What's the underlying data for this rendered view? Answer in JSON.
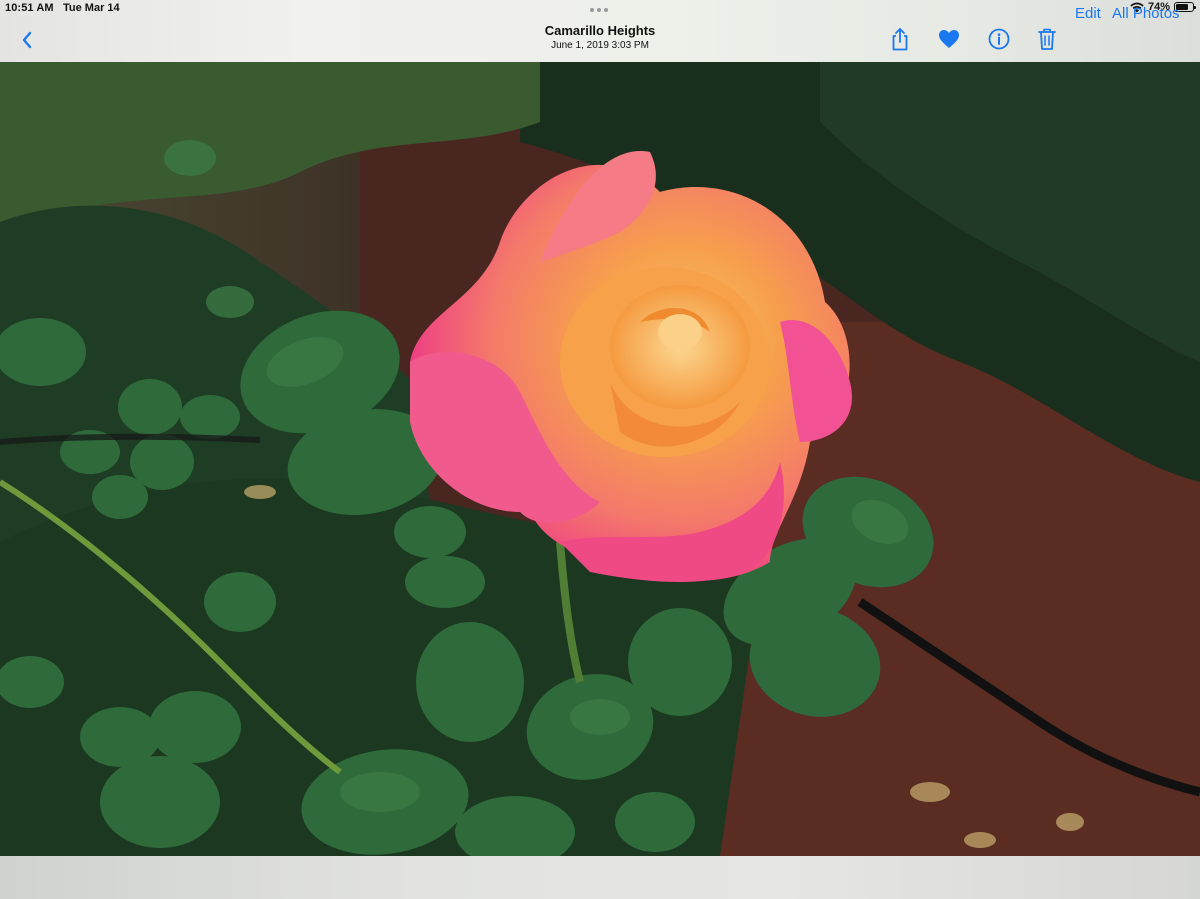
{
  "status_bar": {
    "time": "10:51 AM",
    "date": "Tue Mar 14",
    "battery_percent": "74%",
    "battery_level": 0.74,
    "wifi_icon": "wifi-icon"
  },
  "nav": {
    "back_icon": "chevron-left-icon",
    "title": "Camarillo Heights",
    "subtitle": "June 1, 2019  3:03 PM",
    "edit_label": "Edit",
    "all_photos_label": "All Photos",
    "toolbar_icons": [
      "share-icon",
      "heart-icon",
      "info-icon",
      "trash-icon"
    ],
    "accent_color": "#1a78f0"
  },
  "photo": {
    "subject": "rose-photo",
    "colors": {
      "foliage_dark": "#1e3a22",
      "leaf": "#2e6a3a",
      "mulch": "#5a2c22",
      "petal_pink": "#f04a86",
      "petal_orange": "#f6a04c"
    }
  }
}
